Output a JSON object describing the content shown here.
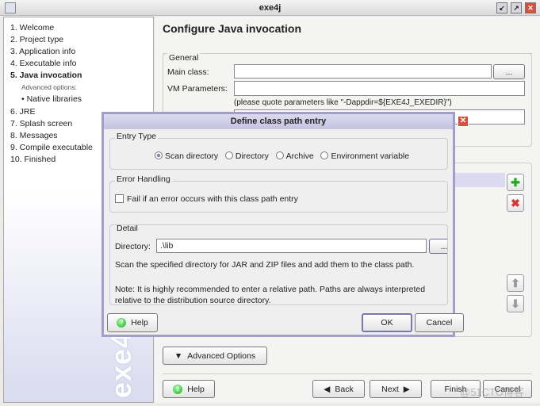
{
  "window": {
    "title": "exe4j",
    "minimize": "↙",
    "maximize": "↗",
    "close": "✕"
  },
  "sidebar": {
    "items": [
      "1. Welcome",
      "2. Project type",
      "3. Application info",
      "4. Executable info",
      "5. Java invocation",
      "Advanced options:",
      "• Native libraries",
      "6. JRE",
      "7. Splash screen",
      "8. Messages",
      "9. Compile executable",
      "10. Finished"
    ],
    "active_index": 4,
    "logo": "exe4j"
  },
  "main": {
    "title": "Configure Java invocation",
    "general": {
      "label": "General",
      "main_class_label": "Main class:",
      "main_class_value": "",
      "browse": "...",
      "vm_params_label": "VM Parameters:",
      "vm_params_value": "",
      "hint": "(please quote parameters like \"-Dappdir=${EXE4J_EXEDIR}\")"
    },
    "advanced_options": "Advanced Options",
    "help": "Help",
    "back": "Back",
    "next": "Next",
    "finish": "Finish",
    "cancel": "Cancel"
  },
  "dialog": {
    "title": "Define class path entry",
    "entry_type": {
      "label": "Entry Type",
      "options": [
        "Scan directory",
        "Directory",
        "Archive",
        "Environment variable"
      ],
      "selected": 0
    },
    "error_handling": {
      "label": "Error Handling",
      "checkbox": "Fail if an error occurs with this class path entry",
      "checked": false
    },
    "detail": {
      "label": "Detail",
      "directory_label": "Directory:",
      "directory_value": ".\\lib",
      "browse": "...",
      "desc": "Scan the specified directory for JAR and ZIP files and add them to the class path.",
      "note": "Note: It is highly recommended to enter a relative path. Paths are always interpreted relative to the distribution source directory."
    },
    "help": "Help",
    "ok": "OK",
    "cancel": "Cancel"
  },
  "watermark": "@51CTO博客"
}
